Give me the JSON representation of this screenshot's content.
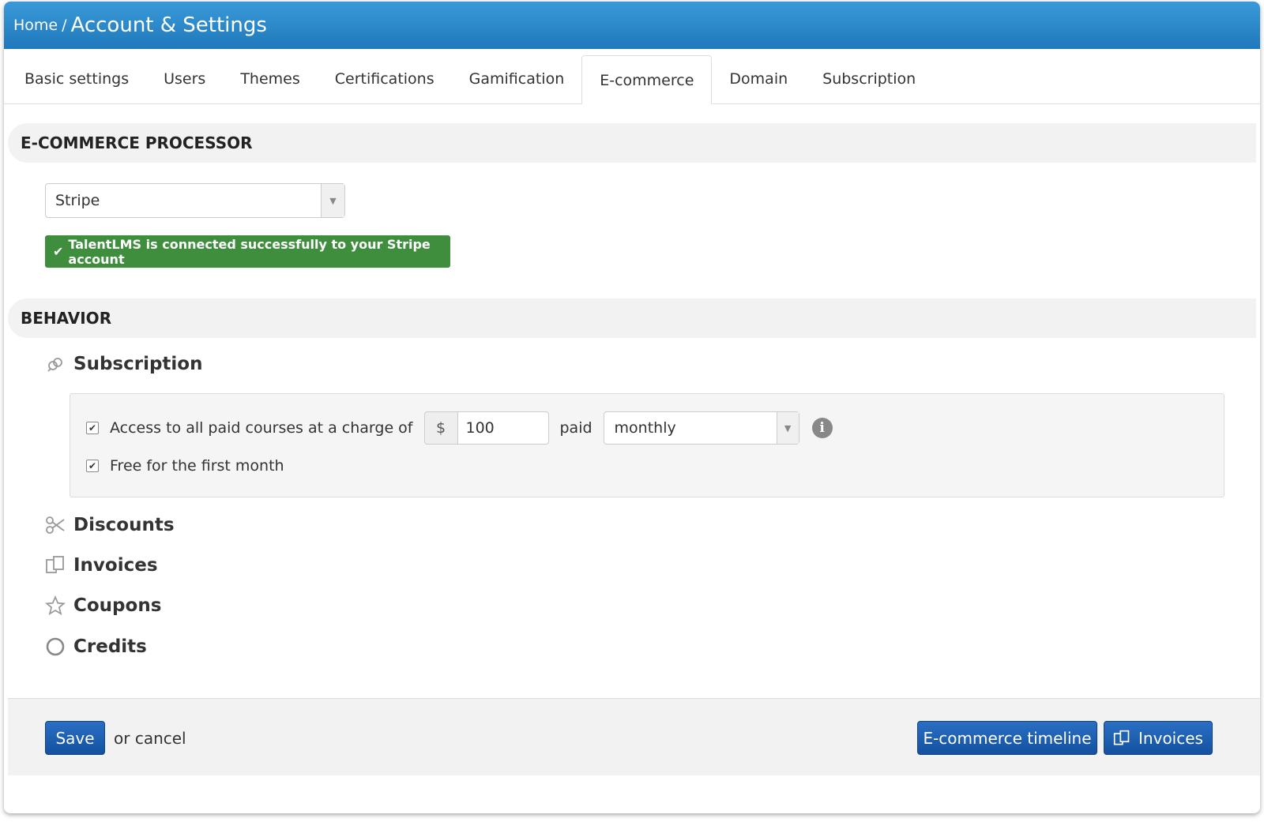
{
  "header": {
    "breadcrumb_home": "Home",
    "breadcrumb_sep": "/",
    "title": "Account & Settings"
  },
  "tabs": [
    {
      "label": "Basic settings",
      "active": false
    },
    {
      "label": "Users",
      "active": false
    },
    {
      "label": "Themes",
      "active": false
    },
    {
      "label": "Certifications",
      "active": false
    },
    {
      "label": "Gamification",
      "active": false
    },
    {
      "label": "E-commerce",
      "active": true
    },
    {
      "label": "Domain",
      "active": false
    },
    {
      "label": "Subscription",
      "active": false
    }
  ],
  "processor": {
    "heading": "E-COMMERCE PROCESSOR",
    "selected": "Stripe",
    "success_message": "TalentLMS is connected successfully to your Stripe account"
  },
  "behavior": {
    "heading": "BEHAVIOR",
    "subscription": {
      "title": "Subscription",
      "access_label": "Access to all paid courses at a charge of",
      "access_checked": true,
      "currency": "$",
      "amount": "100",
      "paid_label": "paid",
      "period": "monthly",
      "free_label": "Free for the first month",
      "free_checked": true
    },
    "discounts": "Discounts",
    "invoices": "Invoices",
    "coupons": "Coupons",
    "credits": "Credits"
  },
  "footer": {
    "save": "Save",
    "or": "or",
    "cancel": "cancel",
    "timeline": "E-commerce timeline",
    "invoices": "Invoices"
  },
  "colors": {
    "header_blue": "#2a89cd",
    "success_green": "#3e8e3e",
    "button_blue": "#1c5fb3"
  }
}
